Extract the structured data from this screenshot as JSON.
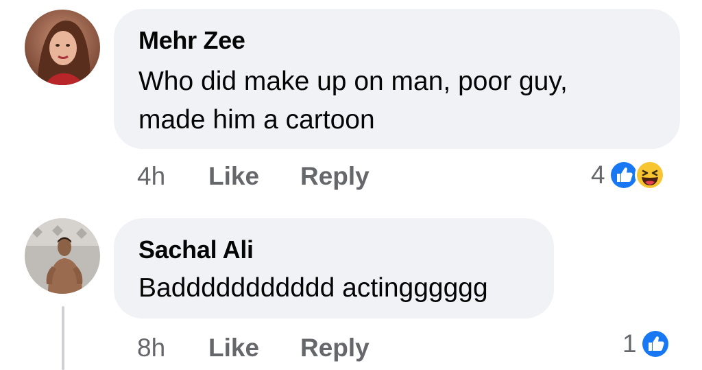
{
  "comments": [
    {
      "author": "Mehr Zee",
      "text_line1": "Who did make up on man, poor guy,",
      "text_line2": "made him a cartoon",
      "time": "4h",
      "like_label": "Like",
      "reply_label": "Reply",
      "reaction_count": "4",
      "reactions": [
        "like-reaction-icon",
        "haha-reaction-icon"
      ]
    },
    {
      "author": "Sachal Ali",
      "text_line1": "Baddddddddddd actingggggg",
      "time": "8h",
      "like_label": "Like",
      "reply_label": "Reply",
      "reaction_count": "1",
      "reactions": [
        "like-reaction-icon"
      ]
    }
  ],
  "colors": {
    "bubble": "#f0f2f5",
    "meta_text": "#65676b",
    "like_blue": "#1877f2",
    "haha_yellow": "#f7c531"
  }
}
